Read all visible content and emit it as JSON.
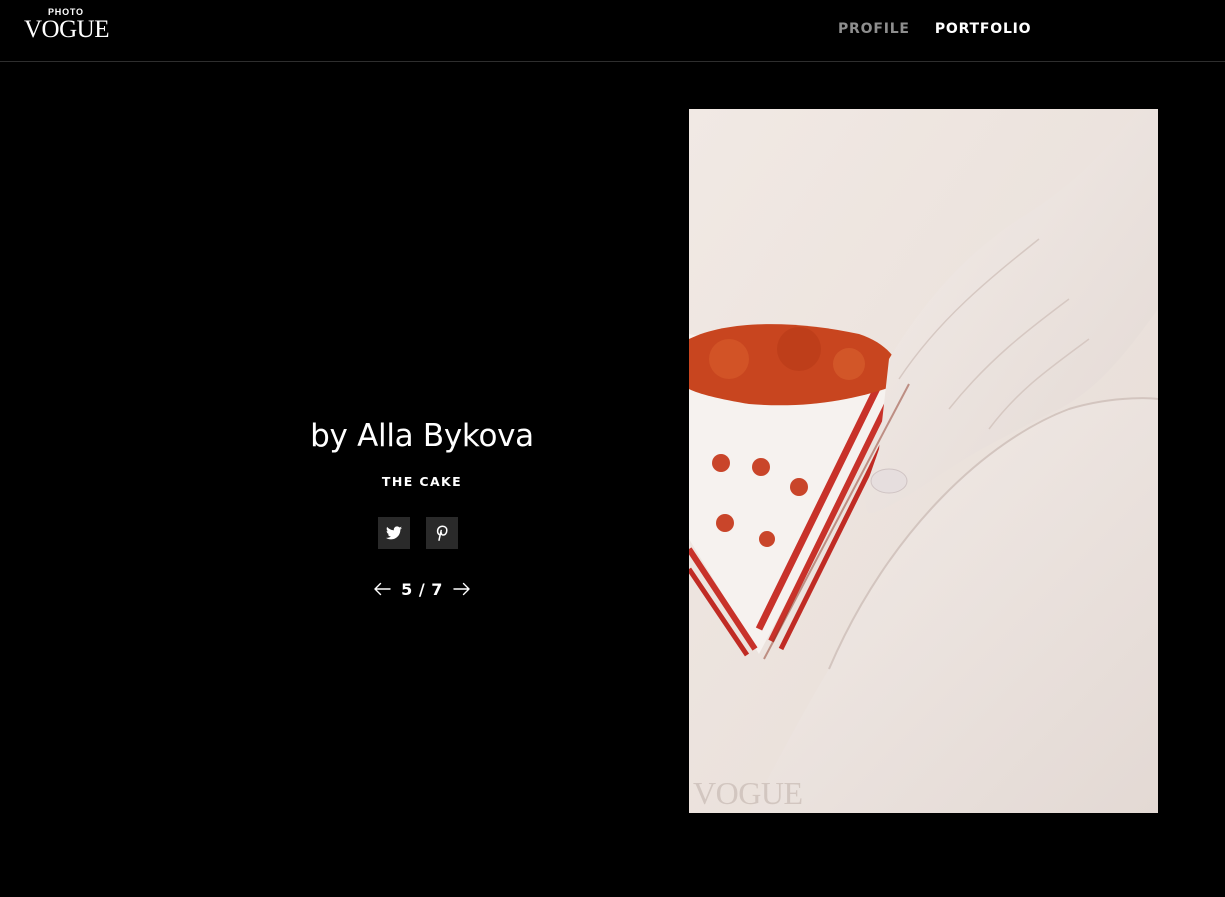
{
  "header": {
    "logo": {
      "small": "PHOTO",
      "big": "VOGUE"
    },
    "nav": [
      {
        "label": "PROFILE",
        "state": "inactive"
      },
      {
        "label": "PORTFOLIO",
        "state": "active"
      }
    ]
  },
  "photo_info": {
    "author": "by Alla Bykova",
    "series": "THE CAKE",
    "share": [
      {
        "icon": "twitter-icon"
      },
      {
        "icon": "pinterest-icon"
      }
    ],
    "pager": {
      "text": "5 / 7",
      "current": 5,
      "total": 7
    }
  },
  "image": {
    "subject": "photograph of a hand holding a slice of red velvet cake",
    "watermark": "VOGUE"
  },
  "colors": {
    "background": "#000000",
    "nav_inactive": "#8e8e8e",
    "nav_active": "#ffffff",
    "share_button_bg": "#2a2a2a"
  }
}
